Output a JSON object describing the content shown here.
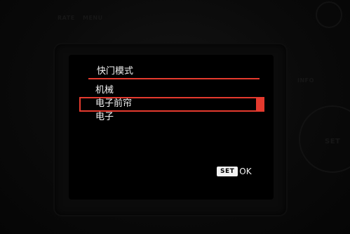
{
  "menu": {
    "title": "快门模式",
    "options": [
      {
        "label": "机械",
        "selected": false
      },
      {
        "label": "电子前帘",
        "selected": true
      },
      {
        "label": "电子",
        "selected": false
      }
    ],
    "set_badge": "SET",
    "ok_label": "OK"
  },
  "camera": {
    "rate_label": "RATE",
    "menu_label": "MENU",
    "info_label": "INFO",
    "set_dial_label": "SET"
  },
  "colors": {
    "accent": "#e53a2e",
    "text": "#f4f4f4",
    "screen_bg": "#000000"
  }
}
